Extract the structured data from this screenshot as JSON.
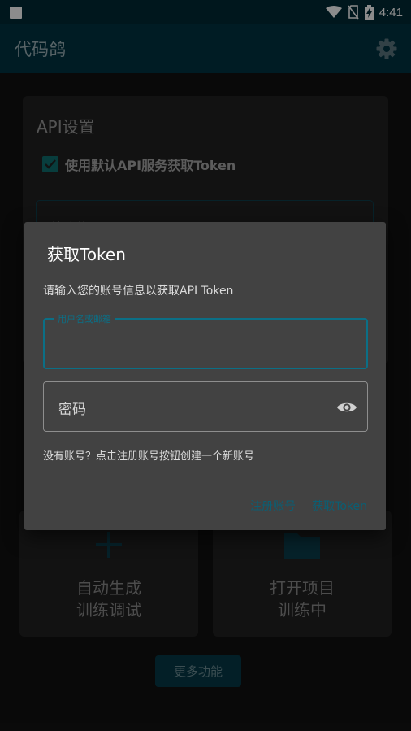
{
  "status_bar": {
    "time": "4:41",
    "icons": [
      "notification-square-icon",
      "wifi-icon",
      "no-sim-icon",
      "battery-charging-icon"
    ]
  },
  "app_bar": {
    "title": "代码鸽",
    "settings_icon": "gear-icon"
  },
  "api_settings": {
    "title": "API设置",
    "use_default_checked": true,
    "use_default_label": "使用默认API服务获取Token",
    "token_input_text": "快速获取Token"
  },
  "features": [
    {
      "line1": "自动生成",
      "line2": "训练调试",
      "icon": "plus-icon"
    },
    {
      "line1": "打开项目",
      "line2": "训练中",
      "icon": "folder-icon"
    }
  ],
  "more_button": "更多功能",
  "dialog": {
    "title": "获取Token",
    "message": "请输入您的账号信息以获取API Token",
    "email_label": "用户名或邮箱",
    "email_value": "",
    "password_label": "密码",
    "password_icon": "eye-icon",
    "hint": "没有账号？点击注册账号按钮创建一个新账号",
    "register_button": "注册账号",
    "get_token_button": "获取Token"
  },
  "colors": {
    "status_bar": "#002a36",
    "app_bar": "#003343",
    "accent": "#0b6f86",
    "dialog_bg": "#424242",
    "card_bg": "#222222"
  }
}
